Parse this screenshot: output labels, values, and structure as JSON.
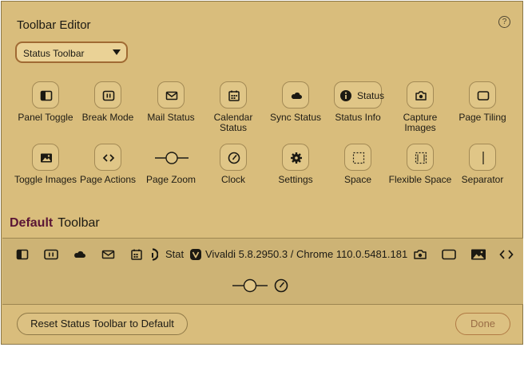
{
  "dialog": {
    "title": "Toolbar Editor",
    "help_symbol": "?",
    "toolbar_select": {
      "value": "Status Toolbar"
    }
  },
  "items": [
    {
      "label": "Panel Toggle",
      "icon": "panel-toggle-icon"
    },
    {
      "label": "Break Mode",
      "icon": "break-mode-icon"
    },
    {
      "label": "Mail Status",
      "icon": "mail-icon"
    },
    {
      "label": "Calendar Status",
      "icon": "calendar-icon"
    },
    {
      "label": "Sync Status",
      "icon": "cloud-icon"
    },
    {
      "label": "Status Info",
      "icon": "info-icon",
      "button_text": "Status"
    },
    {
      "label": "Capture Images",
      "icon": "camera-icon"
    },
    {
      "label": "Page Tiling",
      "icon": "page-tiling-icon"
    },
    {
      "label": "Toggle Images",
      "icon": "image-icon"
    },
    {
      "label": "Page Actions",
      "icon": "code-icon"
    },
    {
      "label": "Page Zoom",
      "icon": "zoom-slider-icon"
    },
    {
      "label": "Clock",
      "icon": "clock-icon"
    },
    {
      "label": "Settings",
      "icon": "gear-icon"
    },
    {
      "label": "Space",
      "icon": "space-icon"
    },
    {
      "label": "Flexible Space",
      "icon": "flexible-space-icon"
    },
    {
      "label": "Separator",
      "icon": "separator-icon"
    }
  ],
  "section": {
    "default_label": "Default",
    "toolbar_label": "Toolbar"
  },
  "preview": {
    "status_truncated": "Statu",
    "version_text": "Vivaldi 5.8.2950.3 / Chrome 110.0.5481.181"
  },
  "footer": {
    "reset_label": "Reset Status Toolbar to Default",
    "done_label": "Done"
  },
  "colors": {
    "dialog_bg": "#d9bd7c",
    "preview_bg": "#cdb375",
    "accent": "#5a1535",
    "select_border": "#a06a33",
    "done_text": "#9a6d45"
  }
}
